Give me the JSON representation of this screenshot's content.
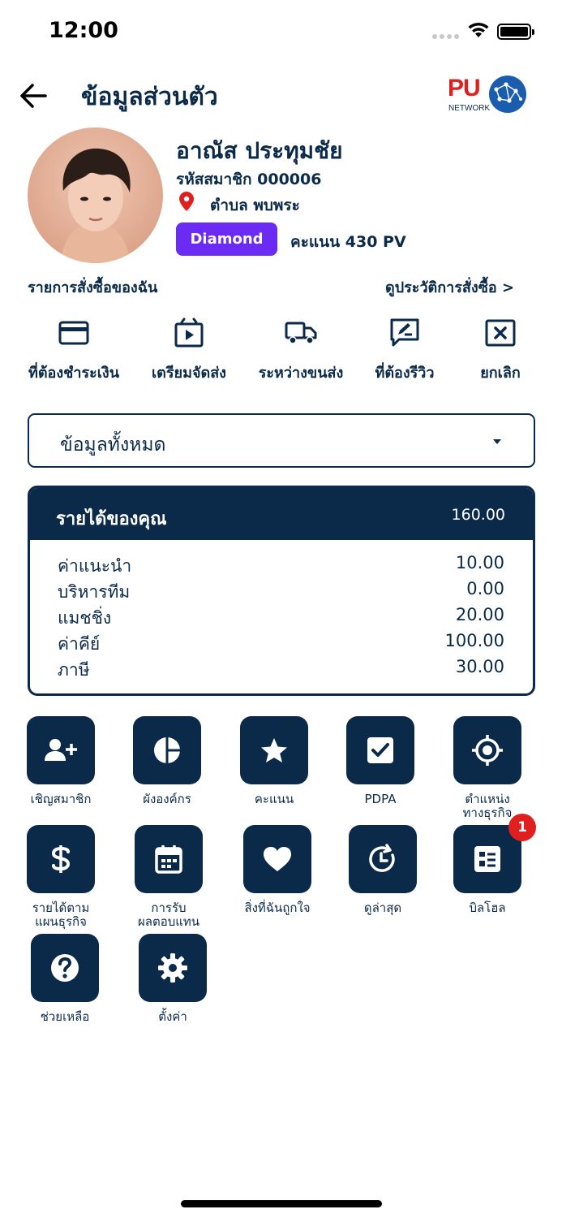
{
  "status_bar": {
    "time": "12:00"
  },
  "header": {
    "title": "ข้อมูลส่วนตัว",
    "logo": {
      "brand": "PU",
      "sub": "NETWORK"
    }
  },
  "profile": {
    "name": "อาณัส ประทุมชัย",
    "member_code": "รหัสสมาชิก 000006",
    "location": "ตำบล พบพระ",
    "level": "Diamond",
    "points": "คะแนน 430 PV"
  },
  "orders": {
    "title": "รายการสั่งซื้อของฉัน",
    "history_link": "ดูประวัติการสั่งซื้อ >",
    "statuses": [
      {
        "label": "ที่ต้องชำระเงิน",
        "icon": "credit-card-icon"
      },
      {
        "label": "เตรียมจัดส่ง",
        "icon": "package-play-icon"
      },
      {
        "label": "ระหว่างขนส่ง",
        "icon": "truck-icon"
      },
      {
        "label": "ที่ต้องรีวิว",
        "icon": "review-icon"
      },
      {
        "label": "ยกเลิก",
        "icon": "cancel-box-icon"
      }
    ]
  },
  "filter": {
    "selected": "ข้อมูลทั้งหมด"
  },
  "income": {
    "title": "รายได้ของคุณ",
    "total": "160.00",
    "rows": [
      {
        "label": "ค่าแนะนำ",
        "value": "10.00"
      },
      {
        "label": "บริหารทีม",
        "value": "0.00"
      },
      {
        "label": "แมชชิ่ง",
        "value": "20.00"
      },
      {
        "label": "ค่าคีย์",
        "value": "100.00"
      },
      {
        "label": "ภาษี",
        "value": "30.00"
      }
    ]
  },
  "menu": {
    "items": [
      {
        "label": "เชิญสมาชิก",
        "icon": "add-user-icon"
      },
      {
        "label": "ผังองค์กร",
        "icon": "pie-chart-icon"
      },
      {
        "label": "คะแนน",
        "icon": "star-icon"
      },
      {
        "label": "PDPA",
        "icon": "checkbox-icon"
      },
      {
        "label": "ตำแหน่ง\nทางธุรกิจ",
        "icon": "target-icon"
      },
      {
        "label": "รายได้ตาม\nแผนธุรกิจ",
        "icon": "dollar-icon"
      },
      {
        "label": "การรับ\nผลตอบแทน",
        "icon": "calendar-icon"
      },
      {
        "label": "สิ่งที่ฉันถูกใจ",
        "icon": "heart-icon"
      },
      {
        "label": "ดูล่าสุด",
        "icon": "history-icon"
      },
      {
        "label": "บิลโฮล",
        "icon": "bill-icon",
        "badge": "1"
      },
      {
        "label": "ช่วยเหลือ",
        "icon": "help-icon"
      },
      {
        "label": "ตั้งค่า",
        "icon": "settings-icon"
      }
    ]
  },
  "colors": {
    "primary": "#0b2a4a",
    "accent": "#6c2bf3",
    "danger": "#e0201f"
  }
}
